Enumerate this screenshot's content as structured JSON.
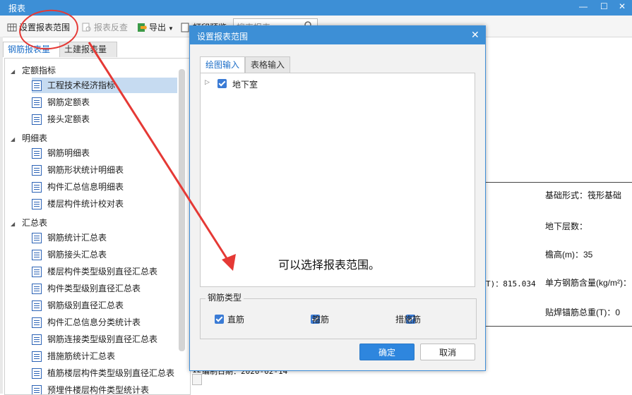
{
  "window": {
    "title": "报表"
  },
  "toolbar": {
    "set_range": "设置报表范围",
    "report_reverse": "报表反查",
    "export": "导出",
    "print_preview": "打印预览",
    "search_placeholder": "搜索报表"
  },
  "left_tabs": [
    "钢筋报表量",
    "土建报表量"
  ],
  "tree": {
    "groups": [
      {
        "label": "定额指标",
        "items": [
          "工程技术经济指标",
          "钢筋定额表",
          "接头定额表"
        ]
      },
      {
        "label": "明细表",
        "items": [
          "钢筋明细表",
          "钢筋形状统计明细表",
          "构件汇总信息明细表",
          "楼层构件统计校对表"
        ]
      },
      {
        "label": "汇总表",
        "items": [
          "钢筋统计汇总表",
          "钢筋接头汇总表",
          "楼层构件类型级别直径汇总表",
          "构件类型级别直径汇总表",
          "钢筋级别直径汇总表",
          "构件汇总信息分类统计表",
          "钢筋连接类型级别直径汇总表",
          "措施筋统计汇总表",
          "植筋楼层构件类型级别直径汇总表",
          "预埋件楼层构件类型统计表"
        ]
      }
    ]
  },
  "report": {
    "foundation_form": "基础形式：筏形基础",
    "basement_floors": "地下层数：",
    "eave_height": "檐高(m)：35",
    "steel_per_area": "单方钢筋含量(kg/m²)：",
    "total_value": "T)：815.034",
    "weld_anchor_total": "贴焊锚筋总重(T)：0",
    "date_line": "编制日期：2020-02-14",
    "row_num": "12"
  },
  "dialog": {
    "title": "设置报表范围",
    "tabs": [
      "绘图输入",
      "表格输入"
    ],
    "tree_node": "地下室",
    "annotation": "可以选择报表范围。",
    "group_label": "钢筋类型",
    "checkboxes": [
      "直筋",
      "箍筋",
      "措施筋"
    ],
    "ok": "确定",
    "cancel": "取消"
  },
  "colors": {
    "accent": "#3d8fd6",
    "primary_button": "#2e86de",
    "annotation": "#e53935"
  }
}
